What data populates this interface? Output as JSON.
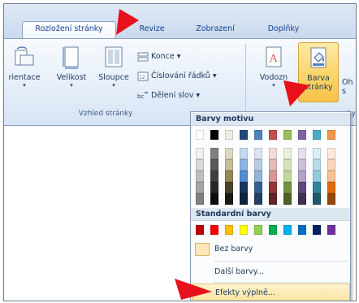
{
  "tabs": [
    {
      "label": "Rozložení stránky",
      "active": true
    },
    {
      "label": "Revize",
      "active": false
    },
    {
      "label": "Zobrazení",
      "active": false
    },
    {
      "label": "Doplňky",
      "active": false
    }
  ],
  "ribbon": {
    "page_setup": {
      "orientation": "rientace",
      "size": "Velikost",
      "columns": "Sloupce",
      "breaks": "Konce",
      "line_numbers": "Číslování řádků",
      "hyphenation": "Dělení slov",
      "group_label": "Vzhled stránky"
    },
    "background": {
      "watermark": "Vodozn",
      "page_color_line1": "Barva",
      "page_color_line2": "stránky",
      "borders_partial": "Oh",
      "borders_partial2": "s",
      "group_label_partial": "ky"
    }
  },
  "dropdown": {
    "theme_colors_header": "Barvy motivu",
    "standard_colors_header": "Standardní barvy",
    "no_color": "Bez barvy",
    "more_colors": "Další barvy...",
    "fill_effects": "Efekty výplně...",
    "theme_colors": [
      [
        "#ffffff",
        "#f2f2f2",
        "#d9d9d9",
        "#bfbfbf",
        "#a6a6a6",
        "#808080"
      ],
      [
        "#000000",
        "#7f7f7f",
        "#595959",
        "#3f3f3f",
        "#262626",
        "#0d0d0d"
      ],
      [
        "#eeece1",
        "#ddd9c3",
        "#c4bd97",
        "#938953",
        "#494429",
        "#1d1b10"
      ],
      [
        "#1f497d",
        "#c6d9f0",
        "#8db3e2",
        "#548dd4",
        "#17365d",
        "#0f243e"
      ],
      [
        "#4f81bd",
        "#dbe5f1",
        "#b8cce4",
        "#95b3d7",
        "#366092",
        "#244061"
      ],
      [
        "#c0504d",
        "#f2dcdb",
        "#e5b9b7",
        "#d99694",
        "#953734",
        "#632423"
      ],
      [
        "#9bbb59",
        "#ebf1dd",
        "#d7e3bc",
        "#c3d69b",
        "#76923c",
        "#4f6128"
      ],
      [
        "#8064a2",
        "#e5e0ec",
        "#ccc1d9",
        "#b2a2c7",
        "#5f497a",
        "#3f3151"
      ],
      [
        "#4bacc6",
        "#dbeef3",
        "#b7dde8",
        "#92cddc",
        "#31859b",
        "#205867"
      ],
      [
        "#f79646",
        "#fdeada",
        "#fbd5b5",
        "#fac08f",
        "#e36c09",
        "#974806"
      ]
    ],
    "standard_colors": [
      "#c00000",
      "#ff0000",
      "#ffc000",
      "#ffff00",
      "#92d050",
      "#00b050",
      "#00b0f0",
      "#0070c0",
      "#002060",
      "#7030a0"
    ]
  }
}
